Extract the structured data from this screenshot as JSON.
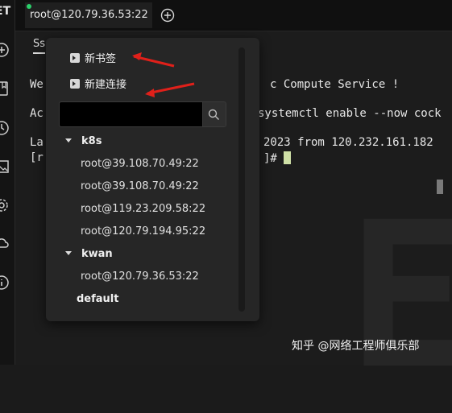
{
  "sidebar": {
    "logo_text": "ET",
    "icons": [
      "plus-circle-icon",
      "bookmark-icon",
      "clock-icon",
      "image-icon",
      "gear-icon",
      "cloud-sync-icon",
      "info-icon"
    ]
  },
  "tabs": [
    {
      "label": "root@120.79.36.53:22",
      "status_color": "#2bd06b"
    }
  ],
  "terminal": {
    "subtab_label": "Ss",
    "lines": [
      {
        "left": "We",
        "right": "c Compute Service !"
      },
      {
        "left": "Ac",
        "right": "systemctl enable --now cock"
      },
      {
        "left": "La",
        "right": "2023 from 120.232.161.182"
      },
      {
        "left": "[r",
        "right": "]#"
      }
    ]
  },
  "menu": {
    "new_bookmark": "新书签",
    "new_connection": "新建连接",
    "search_placeholder": "",
    "groups": [
      {
        "name": "k8s",
        "hosts": [
          "root@39.108.70.49:22",
          "root@39.108.70.49:22",
          "root@119.23.209.58:22",
          "root@120.79.194.95:22"
        ]
      },
      {
        "name": "kwan",
        "hosts": [
          "root@120.79.36.53:22"
        ]
      },
      {
        "name": "default",
        "hosts": []
      }
    ]
  },
  "watermark": "知乎 @网络工程师俱乐部",
  "colors": {
    "arrow": "#e0201a",
    "cursor": "#cfe0a6",
    "status_dot": "#2bd06b"
  }
}
